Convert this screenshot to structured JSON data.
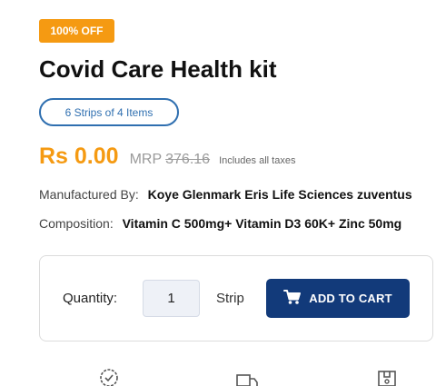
{
  "product": {
    "discount_badge": "100% OFF",
    "title": "Covid Care Health kit",
    "pack_option": "6 Strips of 4 Items",
    "price": "Rs 0.00",
    "mrp_label": "MRP",
    "mrp_value": "376.16",
    "tax_note": "Includes all taxes",
    "manufacturer_label": "Manufactured By:",
    "manufacturer_value": "Koye Glenmark Eris Life Sciences zuventus",
    "composition_label": "Composition:",
    "composition_value": "Vitamin C 500mg+ Vitamin D3 60K+ Zinc 50mg"
  },
  "cart": {
    "quantity_label": "Quantity:",
    "quantity_value": "1",
    "unit_label": "Strip",
    "add_button_label": "ADD TO CART"
  },
  "feature_icons": [
    "verified-quality-icon",
    "delivery-truck-icon",
    "package-box-icon"
  ],
  "colors": {
    "accent_orange": "#f59a12",
    "primary_blue": "#123a7a",
    "pill_blue": "#2f6fb0"
  }
}
